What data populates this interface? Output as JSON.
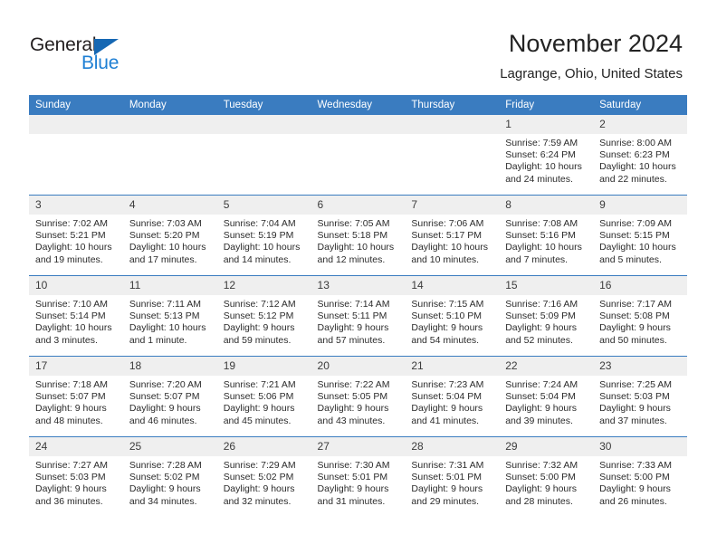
{
  "logo": {
    "word_one": "General",
    "word_two": "Blue",
    "triangle_icon": "blue-triangle-icon",
    "color_dark": "#231f20",
    "color_blue": "#1e7fd4"
  },
  "header": {
    "title": "November 2024",
    "subtitle": "Lagrange, Ohio, United States"
  },
  "theme": {
    "header_blue": "#3a7cc0",
    "daynum_gray": "#efefef",
    "text": "#2b2b2b"
  },
  "calendar": {
    "weekday_headers": [
      "Sunday",
      "Monday",
      "Tuesday",
      "Wednesday",
      "Thursday",
      "Friday",
      "Saturday"
    ],
    "weeks": [
      [
        {
          "day": "",
          "sunrise": "",
          "sunset": "",
          "daylight_a": "",
          "daylight_b": ""
        },
        {
          "day": "",
          "sunrise": "",
          "sunset": "",
          "daylight_a": "",
          "daylight_b": ""
        },
        {
          "day": "",
          "sunrise": "",
          "sunset": "",
          "daylight_a": "",
          "daylight_b": ""
        },
        {
          "day": "",
          "sunrise": "",
          "sunset": "",
          "daylight_a": "",
          "daylight_b": ""
        },
        {
          "day": "",
          "sunrise": "",
          "sunset": "",
          "daylight_a": "",
          "daylight_b": ""
        },
        {
          "day": "1",
          "sunrise": "Sunrise: 7:59 AM",
          "sunset": "Sunset: 6:24 PM",
          "daylight_a": "Daylight: 10 hours",
          "daylight_b": "and 24 minutes."
        },
        {
          "day": "2",
          "sunrise": "Sunrise: 8:00 AM",
          "sunset": "Sunset: 6:23 PM",
          "daylight_a": "Daylight: 10 hours",
          "daylight_b": "and 22 minutes."
        }
      ],
      [
        {
          "day": "3",
          "sunrise": "Sunrise: 7:02 AM",
          "sunset": "Sunset: 5:21 PM",
          "daylight_a": "Daylight: 10 hours",
          "daylight_b": "and 19 minutes."
        },
        {
          "day": "4",
          "sunrise": "Sunrise: 7:03 AM",
          "sunset": "Sunset: 5:20 PM",
          "daylight_a": "Daylight: 10 hours",
          "daylight_b": "and 17 minutes."
        },
        {
          "day": "5",
          "sunrise": "Sunrise: 7:04 AM",
          "sunset": "Sunset: 5:19 PM",
          "daylight_a": "Daylight: 10 hours",
          "daylight_b": "and 14 minutes."
        },
        {
          "day": "6",
          "sunrise": "Sunrise: 7:05 AM",
          "sunset": "Sunset: 5:18 PM",
          "daylight_a": "Daylight: 10 hours",
          "daylight_b": "and 12 minutes."
        },
        {
          "day": "7",
          "sunrise": "Sunrise: 7:06 AM",
          "sunset": "Sunset: 5:17 PM",
          "daylight_a": "Daylight: 10 hours",
          "daylight_b": "and 10 minutes."
        },
        {
          "day": "8",
          "sunrise": "Sunrise: 7:08 AM",
          "sunset": "Sunset: 5:16 PM",
          "daylight_a": "Daylight: 10 hours",
          "daylight_b": "and 7 minutes."
        },
        {
          "day": "9",
          "sunrise": "Sunrise: 7:09 AM",
          "sunset": "Sunset: 5:15 PM",
          "daylight_a": "Daylight: 10 hours",
          "daylight_b": "and 5 minutes."
        }
      ],
      [
        {
          "day": "10",
          "sunrise": "Sunrise: 7:10 AM",
          "sunset": "Sunset: 5:14 PM",
          "daylight_a": "Daylight: 10 hours",
          "daylight_b": "and 3 minutes."
        },
        {
          "day": "11",
          "sunrise": "Sunrise: 7:11 AM",
          "sunset": "Sunset: 5:13 PM",
          "daylight_a": "Daylight: 10 hours",
          "daylight_b": "and 1 minute."
        },
        {
          "day": "12",
          "sunrise": "Sunrise: 7:12 AM",
          "sunset": "Sunset: 5:12 PM",
          "daylight_a": "Daylight: 9 hours",
          "daylight_b": "and 59 minutes."
        },
        {
          "day": "13",
          "sunrise": "Sunrise: 7:14 AM",
          "sunset": "Sunset: 5:11 PM",
          "daylight_a": "Daylight: 9 hours",
          "daylight_b": "and 57 minutes."
        },
        {
          "day": "14",
          "sunrise": "Sunrise: 7:15 AM",
          "sunset": "Sunset: 5:10 PM",
          "daylight_a": "Daylight: 9 hours",
          "daylight_b": "and 54 minutes."
        },
        {
          "day": "15",
          "sunrise": "Sunrise: 7:16 AM",
          "sunset": "Sunset: 5:09 PM",
          "daylight_a": "Daylight: 9 hours",
          "daylight_b": "and 52 minutes."
        },
        {
          "day": "16",
          "sunrise": "Sunrise: 7:17 AM",
          "sunset": "Sunset: 5:08 PM",
          "daylight_a": "Daylight: 9 hours",
          "daylight_b": "and 50 minutes."
        }
      ],
      [
        {
          "day": "17",
          "sunrise": "Sunrise: 7:18 AM",
          "sunset": "Sunset: 5:07 PM",
          "daylight_a": "Daylight: 9 hours",
          "daylight_b": "and 48 minutes."
        },
        {
          "day": "18",
          "sunrise": "Sunrise: 7:20 AM",
          "sunset": "Sunset: 5:07 PM",
          "daylight_a": "Daylight: 9 hours",
          "daylight_b": "and 46 minutes."
        },
        {
          "day": "19",
          "sunrise": "Sunrise: 7:21 AM",
          "sunset": "Sunset: 5:06 PM",
          "daylight_a": "Daylight: 9 hours",
          "daylight_b": "and 45 minutes."
        },
        {
          "day": "20",
          "sunrise": "Sunrise: 7:22 AM",
          "sunset": "Sunset: 5:05 PM",
          "daylight_a": "Daylight: 9 hours",
          "daylight_b": "and 43 minutes."
        },
        {
          "day": "21",
          "sunrise": "Sunrise: 7:23 AM",
          "sunset": "Sunset: 5:04 PM",
          "daylight_a": "Daylight: 9 hours",
          "daylight_b": "and 41 minutes."
        },
        {
          "day": "22",
          "sunrise": "Sunrise: 7:24 AM",
          "sunset": "Sunset: 5:04 PM",
          "daylight_a": "Daylight: 9 hours",
          "daylight_b": "and 39 minutes."
        },
        {
          "day": "23",
          "sunrise": "Sunrise: 7:25 AM",
          "sunset": "Sunset: 5:03 PM",
          "daylight_a": "Daylight: 9 hours",
          "daylight_b": "and 37 minutes."
        }
      ],
      [
        {
          "day": "24",
          "sunrise": "Sunrise: 7:27 AM",
          "sunset": "Sunset: 5:03 PM",
          "daylight_a": "Daylight: 9 hours",
          "daylight_b": "and 36 minutes."
        },
        {
          "day": "25",
          "sunrise": "Sunrise: 7:28 AM",
          "sunset": "Sunset: 5:02 PM",
          "daylight_a": "Daylight: 9 hours",
          "daylight_b": "and 34 minutes."
        },
        {
          "day": "26",
          "sunrise": "Sunrise: 7:29 AM",
          "sunset": "Sunset: 5:02 PM",
          "daylight_a": "Daylight: 9 hours",
          "daylight_b": "and 32 minutes."
        },
        {
          "day": "27",
          "sunrise": "Sunrise: 7:30 AM",
          "sunset": "Sunset: 5:01 PM",
          "daylight_a": "Daylight: 9 hours",
          "daylight_b": "and 31 minutes."
        },
        {
          "day": "28",
          "sunrise": "Sunrise: 7:31 AM",
          "sunset": "Sunset: 5:01 PM",
          "daylight_a": "Daylight: 9 hours",
          "daylight_b": "and 29 minutes."
        },
        {
          "day": "29",
          "sunrise": "Sunrise: 7:32 AM",
          "sunset": "Sunset: 5:00 PM",
          "daylight_a": "Daylight: 9 hours",
          "daylight_b": "and 28 minutes."
        },
        {
          "day": "30",
          "sunrise": "Sunrise: 7:33 AM",
          "sunset": "Sunset: 5:00 PM",
          "daylight_a": "Daylight: 9 hours",
          "daylight_b": "and 26 minutes."
        }
      ]
    ]
  }
}
